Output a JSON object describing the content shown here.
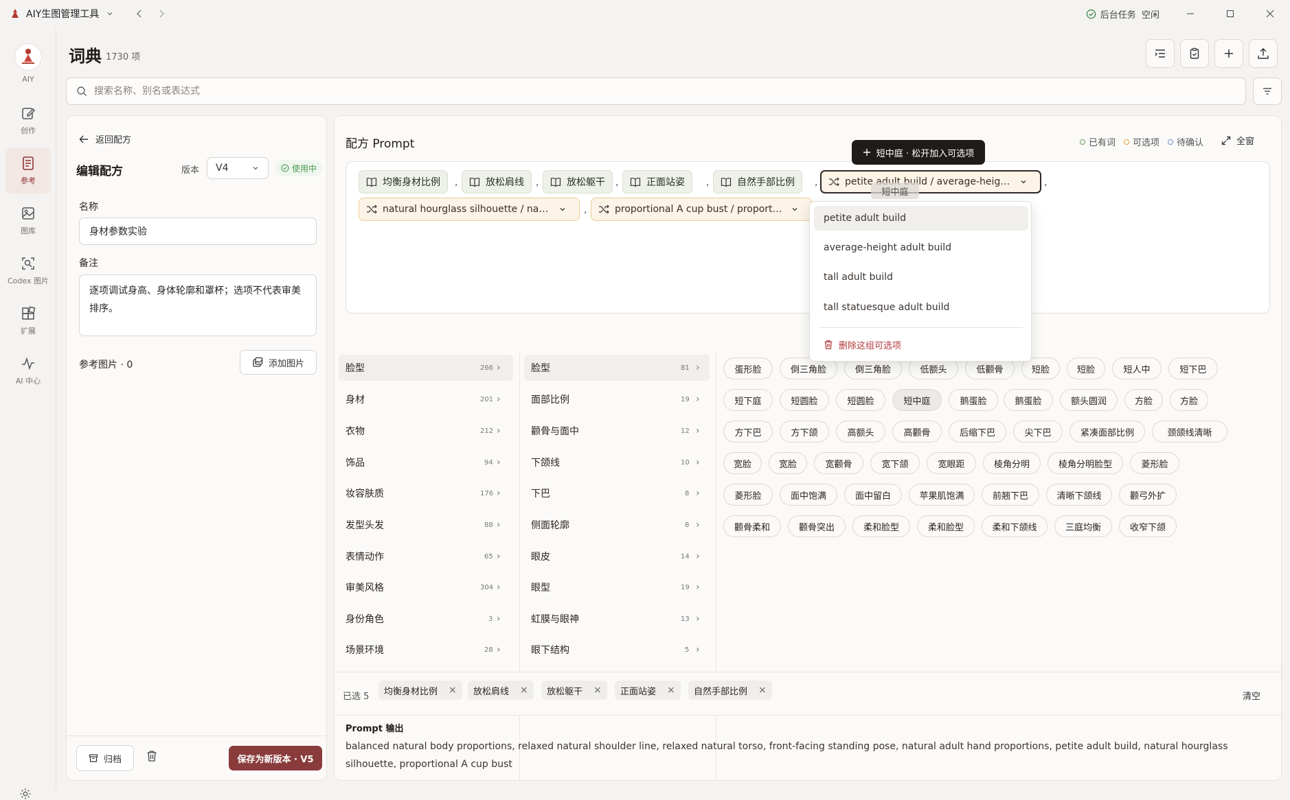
{
  "titlebar": {
    "app_name": "AIY生图管理工具",
    "task_label": "后台任务",
    "task_status": "空闲"
  },
  "sidebar": {
    "logo_label": "AIY",
    "items": [
      {
        "label": "创作",
        "icon": "edit-icon",
        "active": false
      },
      {
        "label": "参考",
        "icon": "document-icon",
        "active": true
      },
      {
        "label": "图库",
        "icon": "gallery-icon",
        "active": false
      },
      {
        "label": "Codex 图片",
        "icon": "scan-icon",
        "active": false
      },
      {
        "label": "扩展",
        "icon": "extensions-icon",
        "active": false
      },
      {
        "label": "AI 中心",
        "icon": "activity-icon",
        "active": false
      }
    ]
  },
  "header": {
    "title": "词典",
    "count": "1730 项"
  },
  "search": {
    "placeholder": "搜索名称、别名或表达式"
  },
  "left_panel": {
    "back_label": "返回配方",
    "title": "编辑配方",
    "version_label": "版本",
    "version_value": "V4",
    "status_badge": "使用中",
    "name_label": "名称",
    "name_value": "身材参数实验",
    "note_label": "备注",
    "note_value": "逐项调试身高、身体轮廓和罩杯；选项不代表审美排序。",
    "ref_images_label": "参考图片 · 0",
    "add_image_label": "添加图片",
    "archive_label": "归档",
    "save_label": "保存为新版本 · V5"
  },
  "prompt_panel": {
    "title": "配方 Prompt",
    "legend": [
      {
        "label": "已有词",
        "color": "#6c9a5a"
      },
      {
        "label": "可选项",
        "color": "#e0a23c"
      },
      {
        "label": "待确认",
        "color": "#6a8fc9"
      }
    ],
    "fullscreen_label": "全窗",
    "fixed_chips": [
      "均衡身材比例",
      "放松肩线",
      "放松躯干",
      "正面站姿",
      "自然手部比例"
    ],
    "option_chips": [
      "petite adult build / average-height a...",
      "natural hourglass silhouette / natural...",
      "proportional A cup bust / proportion..."
    ],
    "tooltip": "短中庭 · 松开加入可选项",
    "drag_ghost": "短中庭",
    "dropdown": {
      "options": [
        "petite adult build",
        "average-height adult build",
        "tall adult build",
        "tall statuesque adult build"
      ],
      "selected": "petite adult build",
      "delete_label": "删除这组可选项"
    }
  },
  "categories": [
    {
      "label": "脸型",
      "count": "266"
    },
    {
      "label": "身材",
      "count": "201"
    },
    {
      "label": "衣物",
      "count": "212"
    },
    {
      "label": "饰品",
      "count": "94"
    },
    {
      "label": "妆容肤质",
      "count": "176"
    },
    {
      "label": "发型头发",
      "count": "88"
    },
    {
      "label": "表情动作",
      "count": "65"
    },
    {
      "label": "审美风格",
      "count": "304"
    },
    {
      "label": "身份角色",
      "count": "3"
    },
    {
      "label": "场景环境",
      "count": "28"
    }
  ],
  "subcategories": [
    {
      "label": "脸型",
      "count": "81"
    },
    {
      "label": "面部比例",
      "count": "19"
    },
    {
      "label": "颧骨与面中",
      "count": "12"
    },
    {
      "label": "下颌线",
      "count": "10"
    },
    {
      "label": "下巴",
      "count": "8"
    },
    {
      "label": "侧面轮廓",
      "count": "8"
    },
    {
      "label": "眼皮",
      "count": "14"
    },
    {
      "label": "眼型",
      "count": "19"
    },
    {
      "label": "虹膜与眼神",
      "count": "13"
    },
    {
      "label": "眼下结构",
      "count": "5"
    }
  ],
  "tag_rows": [
    [
      "蛋形脸",
      "倒三角脸",
      "倒三角脸",
      "低额头",
      "低颧骨",
      "短脸",
      "短脸",
      "短人中",
      "短下巴"
    ],
    [
      "短下庭",
      "短圆脸",
      "短圆脸",
      "短中庭",
      "鹅蛋脸",
      "鹅蛋脸",
      "额头圆润",
      "方脸",
      "方脸"
    ],
    [
      "方下巴",
      "方下颌",
      "高额头",
      "高颧骨",
      "后缩下巴",
      "尖下巴",
      "紧凑面部比例",
      "颈颌线清晰"
    ],
    [
      "宽脸",
      "宽脸",
      "宽颧骨",
      "宽下颌",
      "宽眼距",
      "棱角分明",
      "棱角分明脸型",
      "菱形脸"
    ],
    [
      "菱形脸",
      "面中饱满",
      "面中留白",
      "苹果肌饱满",
      "前翘下巴",
      "清晰下颌线",
      "颧弓外扩"
    ],
    [
      "颧骨柔和",
      "颧骨突出",
      "柔和脸型",
      "柔和脸型",
      "柔和下颌线",
      "三庭均衡",
      "收窄下颌"
    ]
  ],
  "selected_bar": {
    "label": "已选 5",
    "items": [
      "均衡身材比例",
      "放松肩线",
      "放松躯干",
      "正面站姿",
      "自然手部比例"
    ],
    "clear_label": "清空"
  },
  "output": {
    "label": "Prompt 输出",
    "text": "balanced natural body proportions, relaxed natural shoulder line, relaxed natural torso, front-facing standing pose, natural adult hand proportions, petite adult build, natural hourglass silhouette, proportional A cup bust"
  }
}
